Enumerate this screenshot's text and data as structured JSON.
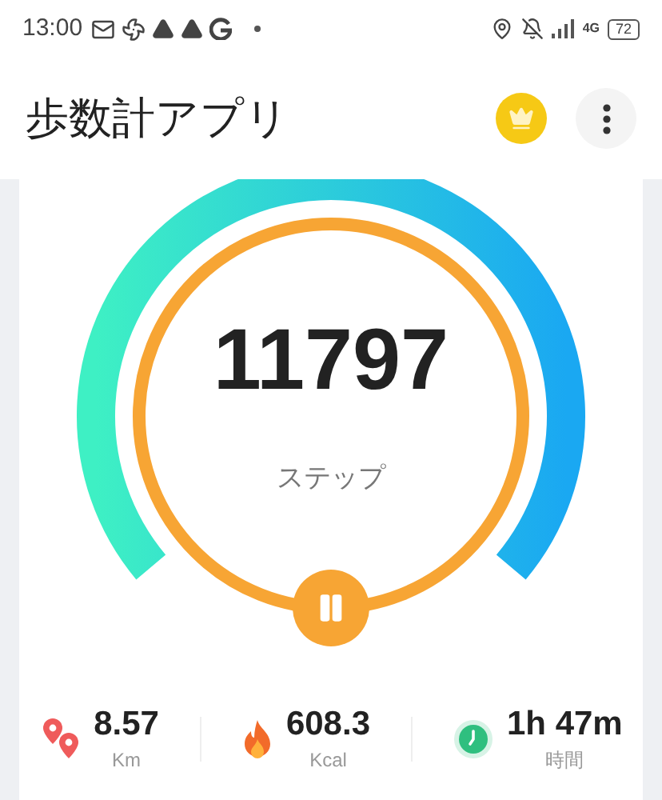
{
  "status_bar": {
    "time": "13:00",
    "network": "4G",
    "battery": "72"
  },
  "header": {
    "title": "歩数計アプリ"
  },
  "steps": {
    "count": "11797",
    "unit": "ステップ"
  },
  "stats": [
    {
      "kind": "distance",
      "value": "8.57",
      "unit": "Km"
    },
    {
      "kind": "calories",
      "value": "608.3",
      "unit": "Kcal"
    },
    {
      "kind": "time",
      "value": "1h 47m",
      "unit": "時間"
    }
  ]
}
